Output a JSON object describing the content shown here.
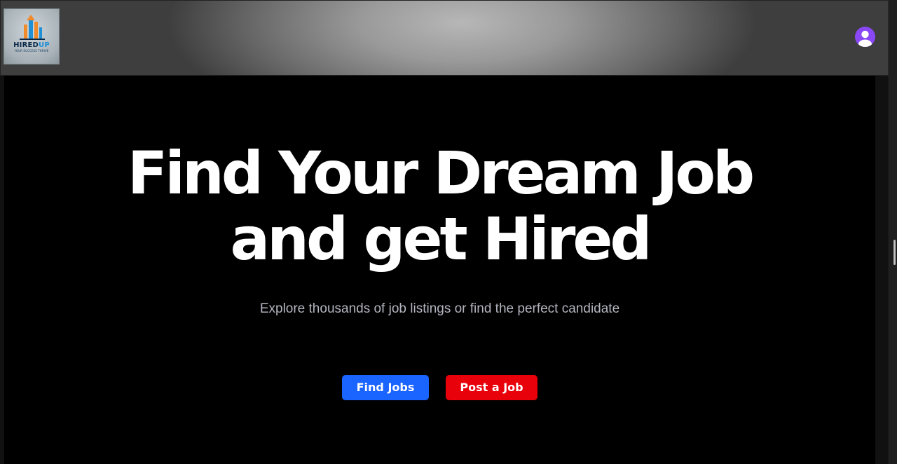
{
  "header": {
    "logo": {
      "brand_main": "HIRED",
      "brand_accent": "UP",
      "tagline": "YOUR SUCCESS THRIVE"
    },
    "user_avatar": {
      "icon": "user-avatar-icon",
      "color": "#8a47f5"
    }
  },
  "hero": {
    "title_line1": "Find Your Dream Job",
    "title_line2": "and get Hired",
    "subtitle": "Explore thousands of job listings or find the perfect candidate",
    "buttons": {
      "find_jobs": {
        "label": "Find Jobs",
        "color": "#1a64ff"
      },
      "post_job": {
        "label": "Post a Job",
        "color": "#e8000b"
      }
    }
  }
}
